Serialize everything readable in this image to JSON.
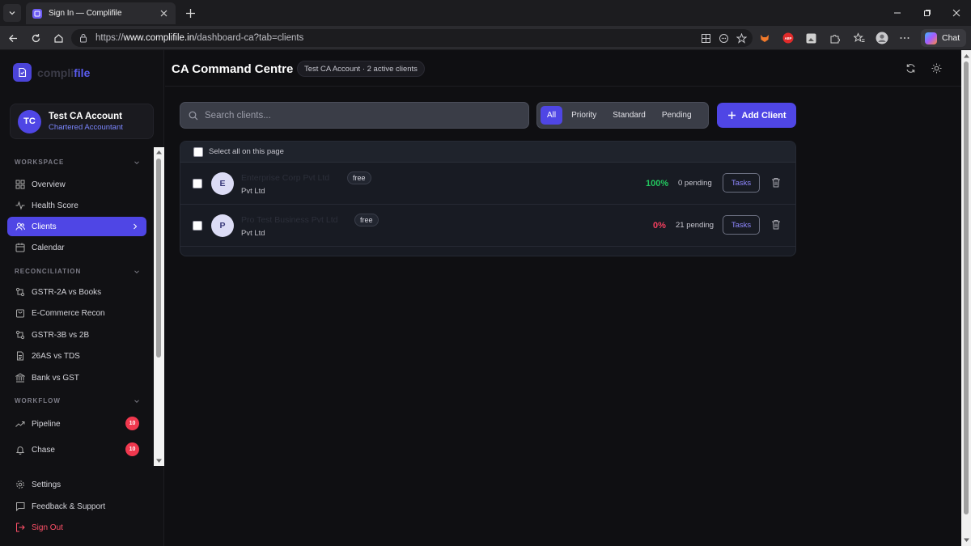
{
  "browser": {
    "tab_title": "Sign In — Complifile",
    "url_prefix": "https://",
    "url_host": "www.complifile.in",
    "url_path": "/dashboard-ca?tab=clients",
    "chat_label": "Chat",
    "abp_label": "ABP"
  },
  "app": {
    "logo_part1": "compli",
    "logo_part2": "file",
    "account": {
      "initials": "TC",
      "name": "Test CA Account",
      "role": "Chartered Accountant"
    },
    "page_title": "CA Command Centre",
    "account_pill": "Test CA Account · 2 active clients"
  },
  "sidebar": {
    "workspace": {
      "label": "WORKSPACE",
      "items": [
        {
          "label": "Overview",
          "icon": "grid-icon"
        },
        {
          "label": "Health Score",
          "icon": "pulse-icon"
        },
        {
          "label": "Clients",
          "icon": "users-icon",
          "active": true
        },
        {
          "label": "Calendar",
          "icon": "calendar-icon"
        }
      ]
    },
    "reconciliation": {
      "label": "RECONCILIATION",
      "items": [
        {
          "label": "GSTR-2A vs Books",
          "icon": "compare-icon"
        },
        {
          "label": "E-Commerce Recon",
          "icon": "cart-icon"
        },
        {
          "label": "GSTR-3B vs 2B",
          "icon": "compare-icon"
        },
        {
          "label": "26AS vs TDS",
          "icon": "document-icon"
        },
        {
          "label": "Bank vs GST",
          "icon": "bank-icon"
        }
      ]
    },
    "workflow": {
      "label": "WORKFLOW",
      "items": [
        {
          "label": "Pipeline",
          "icon": "trend-icon",
          "badge": "10"
        },
        {
          "label": "Chase",
          "icon": "bell-icon",
          "badge": "10"
        }
      ]
    },
    "bottom": {
      "settings": "Settings",
      "feedback": "Feedback & Support",
      "signout": "Sign Out"
    }
  },
  "toolbar": {
    "search_placeholder": "Search clients...",
    "filters": [
      "All",
      "Priority",
      "Standard",
      "Pending"
    ],
    "active_filter": "All",
    "add_client": "Add Client"
  },
  "clients": {
    "select_all": "Select all on this page",
    "rows": [
      {
        "initial": "E",
        "name": "Enterprise Corp Pvt Ltd",
        "plan": "free",
        "type": "Pvt Ltd",
        "progress": "100%",
        "pending": "0 pending",
        "tasks": "Tasks",
        "color": "#22c55e"
      },
      {
        "initial": "P",
        "name": "Pro Test Business Pvt Ltd",
        "plan": "free",
        "type": "Pvt Ltd",
        "progress": "0%",
        "pending": "21 pending",
        "tasks": "Tasks",
        "color": "#f43f5e"
      }
    ]
  },
  "colors": {
    "accent": "#4f46e5",
    "danger": "#f0384e",
    "success": "#22c55e"
  }
}
